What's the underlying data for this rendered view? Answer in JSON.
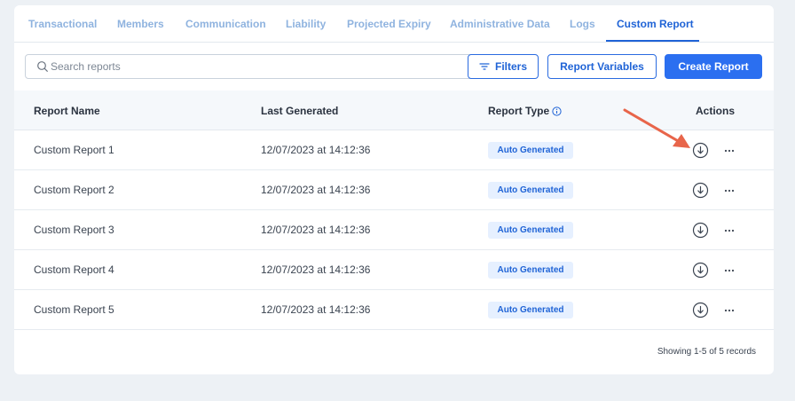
{
  "tabs": [
    {
      "label": "Transactional",
      "active": false
    },
    {
      "label": "Members",
      "active": false
    },
    {
      "label": "Communication",
      "active": false
    },
    {
      "label": "Liability",
      "active": false
    },
    {
      "label": "Projected Expiry",
      "active": false
    },
    {
      "label": "Administrative Data",
      "active": false
    },
    {
      "label": "Logs",
      "active": false
    },
    {
      "label": "Custom Report",
      "active": true
    }
  ],
  "search": {
    "placeholder": "Search reports",
    "icon": "search-icon"
  },
  "toolbar": {
    "filters_label": "Filters",
    "variables_label": "Report Variables",
    "create_label": "Create Report"
  },
  "table": {
    "headers": {
      "name": "Report Name",
      "last_generated": "Last Generated",
      "type": "Report Type",
      "actions": "Actions"
    },
    "rows": [
      {
        "name": "Custom  Report 1",
        "last_generated": "12/07/2023 at 14:12:36",
        "type": "Auto Generated"
      },
      {
        "name": "Custom  Report 2",
        "last_generated": "12/07/2023 at 14:12:36",
        "type": "Auto Generated"
      },
      {
        "name": "Custom  Report 3",
        "last_generated": "12/07/2023 at 14:12:36",
        "type": "Auto Generated"
      },
      {
        "name": "Custom  Report 4",
        "last_generated": "12/07/2023 at 14:12:36",
        "type": "Auto Generated"
      },
      {
        "name": "Custom  Report 5",
        "last_generated": "12/07/2023 at 14:12:36",
        "type": "Auto Generated"
      }
    ]
  },
  "pagination": {
    "summary": "Showing 1-5 of 5 records"
  },
  "colors": {
    "accent": "#1f63d6",
    "primary_button": "#2b6ff0",
    "badge_bg": "#e6f0ff",
    "annotation_arrow": "#e8654a"
  }
}
